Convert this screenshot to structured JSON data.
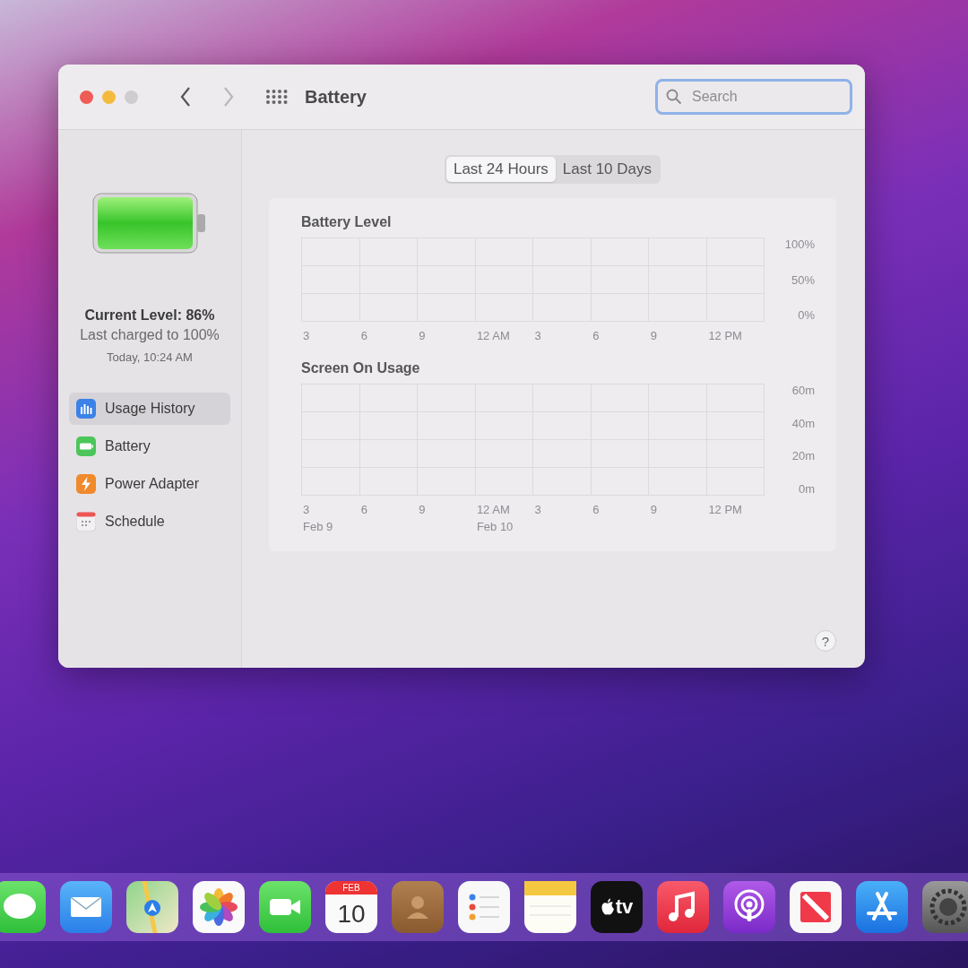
{
  "window": {
    "title": "Battery",
    "controls": [
      {
        "kind": "close",
        "disabled": false
      },
      {
        "kind": "minimize",
        "disabled": false
      },
      {
        "kind": "zoom",
        "disabled": true
      }
    ],
    "nav": [
      {
        "kind": "back",
        "disabled": false
      },
      {
        "kind": "forward",
        "disabled": true
      }
    ],
    "search": {
      "placeholder": "Search"
    }
  },
  "sidebar": {
    "current_level": "Current Level: 86%",
    "last_charged": "Last charged to 100%",
    "charged_time": "Today, 10:24 AM",
    "items": [
      {
        "label": "Usage History",
        "kind": "usage",
        "selected": true
      },
      {
        "label": "Battery",
        "kind": "battery",
        "selected": false
      },
      {
        "label": "Power Adapter",
        "kind": "power",
        "selected": false
      },
      {
        "label": "Schedule",
        "kind": "schedule",
        "selected": false
      }
    ]
  },
  "tabs": [
    {
      "label": "Last 24 Hours",
      "selected": true
    },
    {
      "label": "Last 10 Days",
      "selected": false
    }
  ],
  "charts": [
    {
      "title": "Battery Level",
      "y_labels": [
        "100%",
        "50%",
        "0%"
      ],
      "x_labels": [
        {
          "label": "3"
        },
        {
          "label": "6"
        },
        {
          "label": "9"
        },
        {
          "label": "12 AM"
        },
        {
          "label": "3"
        },
        {
          "label": "6"
        },
        {
          "label": "9"
        },
        {
          "label": "12 PM"
        }
      ]
    },
    {
      "title": "Screen On Usage",
      "y_labels": [
        "60m",
        "40m",
        "20m",
        "0m"
      ],
      "x_labels": [
        {
          "label": "3",
          "date": "Feb 9"
        },
        {
          "label": "6"
        },
        {
          "label": "9"
        },
        {
          "label": "12 AM",
          "date": "Feb 10"
        },
        {
          "label": "3"
        },
        {
          "label": "6"
        },
        {
          "label": "9"
        },
        {
          "label": "12 PM"
        }
      ]
    }
  ],
  "help": "?",
  "dock": [
    {
      "kind": "messages"
    },
    {
      "kind": "mail"
    },
    {
      "kind": "maps"
    },
    {
      "kind": "photos"
    },
    {
      "kind": "facetime"
    },
    {
      "kind": "calendar",
      "month": "FEB",
      "day": "10"
    },
    {
      "kind": "contacts"
    },
    {
      "kind": "reminders"
    },
    {
      "kind": "notes"
    },
    {
      "kind": "tv",
      "label": "tv"
    },
    {
      "kind": "music"
    },
    {
      "kind": "podcasts"
    },
    {
      "kind": "news"
    },
    {
      "kind": "appstore"
    },
    {
      "kind": "settings"
    }
  ]
}
